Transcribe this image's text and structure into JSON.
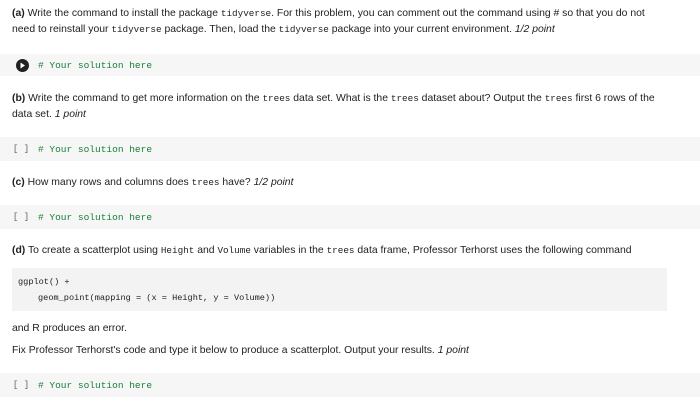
{
  "sections": {
    "a": {
      "label": "(a)",
      "t1": " Write the command to install the package ",
      "c1": "tidyverse",
      "t2": ". For this problem, you can comment out the command using # so that you do not",
      "t3": "need to reinstall your ",
      "c2": "tidyverse",
      "t4": " package. Then, load the ",
      "c3": "tidyverse",
      "t5": " package into your current environment. ",
      "points": "1/2 point"
    },
    "b": {
      "label": "(b)",
      "t1": " Write the command to get more information on the ",
      "c1": "trees",
      "t2": " data set. What is the ",
      "c2": "trees",
      "t3": " dataset about? Output the ",
      "c3": "trees",
      "t4": " first 6 rows of the",
      "t5": "data set. ",
      "points": "1 point"
    },
    "c": {
      "label": "(c)",
      "t1": " How many rows and columns does ",
      "c1": "trees",
      "t2": " have? ",
      "points": "1/2 point"
    },
    "d": {
      "label": "(d)",
      "t1": " To create a scatterplot using ",
      "c1": "Height",
      "t2": " and ",
      "c2": "Volume",
      "t3": " variables in the ",
      "c3": "trees",
      "t4": " data frame, Professor Terhorst uses the following command",
      "code_line1": "ggplot() +",
      "code_line2": "geom_point(mapping = (x = Height, y = Volume))",
      "after1": "and R produces an error.",
      "after2": "Fix Professor Terhorst's code and type it below to produce a scatterplot. Output your results. ",
      "points": "1 point"
    }
  },
  "cells": {
    "placeholder": "# Your solution here",
    "brackets": "[ ]"
  }
}
